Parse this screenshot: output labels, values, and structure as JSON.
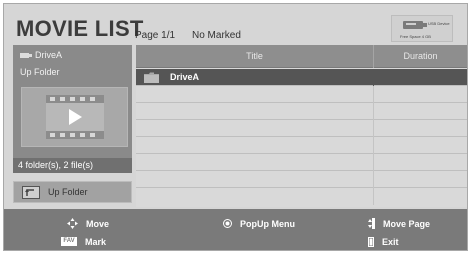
{
  "header": {
    "title": "MOVIE LIST",
    "page": "Page 1/1",
    "marked": "No Marked",
    "device": {
      "name": "USB Device",
      "free_space": "Free Space 4 GB"
    }
  },
  "left_panel": {
    "drive_label": "DriveA",
    "folder_label": "Up Folder",
    "counts": "4 folder(s), 2 file(s)",
    "up_button_label": "Up Folder"
  },
  "list": {
    "columns": [
      "Title",
      "Duration"
    ],
    "rows": [
      {
        "name": "DriveA",
        "type": "folder",
        "duration": ""
      }
    ]
  },
  "footer": {
    "hints": [
      {
        "icon": "navigation-arrows-icon",
        "label": "Move"
      },
      {
        "icon": "ok-circle-icon",
        "label": "PopUp Menu"
      },
      {
        "icon": "page-updown-icon",
        "label": "Move Page"
      },
      {
        "icon": "fav-key-icon",
        "label": "Mark",
        "key_text": "FAV"
      },
      {
        "icon": "exit-key-icon",
        "label": "Exit"
      }
    ]
  },
  "colors": {
    "background": "#d6d6d6",
    "panel": "#8a8a8a",
    "selected_row": "#555555",
    "footer": "#7a7a7a"
  }
}
